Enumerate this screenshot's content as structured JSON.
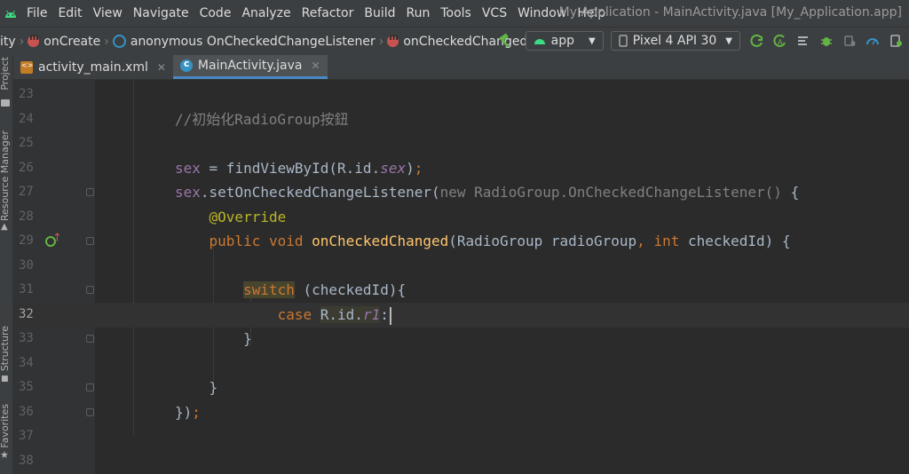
{
  "menubar": {
    "items": [
      "File",
      "Edit",
      "View",
      "Navigate",
      "Code",
      "Analyze",
      "Refactor",
      "Build",
      "Run",
      "Tools",
      "VCS",
      "Window",
      "Help"
    ],
    "title": "My Application - MainActivity.java [My_Application.app]"
  },
  "breadcrumb": {
    "items": [
      "ity",
      "onCreate",
      "anonymous OnCheckedChangeListener",
      "onCheckedChanged"
    ]
  },
  "toolbar": {
    "run_config": "app",
    "device": "Pixel 4 API 30"
  },
  "sidebar": {
    "project_label": "Project",
    "resource_manager_label": "Resource Manager",
    "structure_label": "Structure",
    "favorites_label": "Favorites"
  },
  "tabs": [
    {
      "label": "activity_main.xml",
      "active": false
    },
    {
      "label": "MainActivity.java",
      "active": true
    }
  ],
  "editor": {
    "current_line": "32",
    "line_numbers": [
      "23",
      "24",
      "25",
      "26",
      "27",
      "28",
      "29",
      "30",
      "31",
      "32",
      "33",
      "34",
      "35",
      "36",
      "37",
      "38"
    ],
    "comment_text": "//初始化RadioGroup按鈕"
  },
  "colors": {
    "keyword": "#cc7832",
    "field": "#9876aa",
    "function": "#ffc66d",
    "annotation": "#bbb529",
    "comment": "#808080",
    "text": "#a9b7c6",
    "accent": "#4a88c7"
  }
}
